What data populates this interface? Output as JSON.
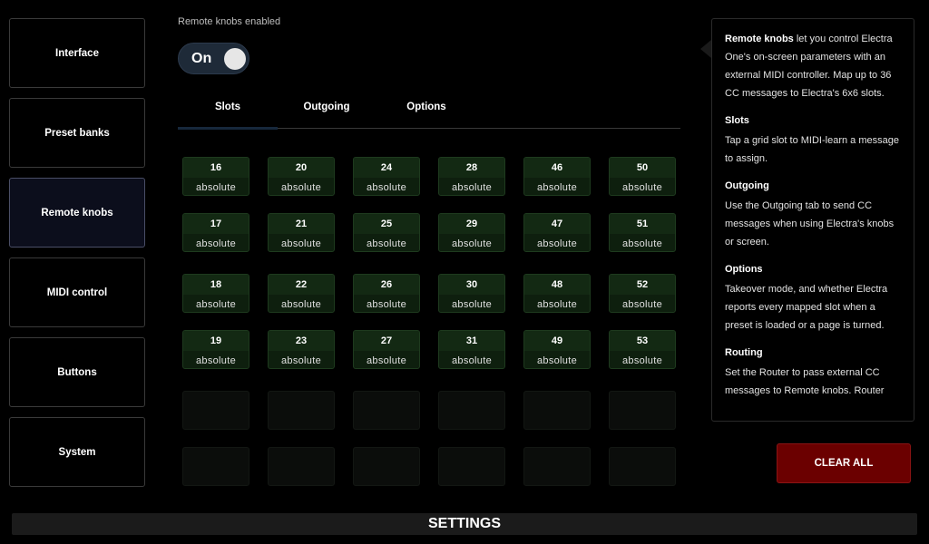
{
  "sidebar": {
    "items": [
      {
        "label": "Interface",
        "active": false
      },
      {
        "label": "Preset banks",
        "active": false
      },
      {
        "label": "Remote knobs",
        "active": true
      },
      {
        "label": "MIDI control",
        "active": false
      },
      {
        "label": "Buttons",
        "active": false
      },
      {
        "label": "System",
        "active": false
      }
    ]
  },
  "main": {
    "enabled_label": "Remote knobs enabled",
    "toggle": {
      "label": "On",
      "state": true
    },
    "tabs": [
      {
        "label": "Slots",
        "active": true
      },
      {
        "label": "Outgoing",
        "active": false
      },
      {
        "label": "Options",
        "active": false
      }
    ],
    "slot_rows": [
      [
        {
          "cc": "16",
          "mode": "absolute"
        },
        {
          "cc": "20",
          "mode": "absolute"
        },
        {
          "cc": "24",
          "mode": "absolute"
        },
        {
          "cc": "28",
          "mode": "absolute"
        },
        {
          "cc": "46",
          "mode": "absolute"
        },
        {
          "cc": "50",
          "mode": "absolute"
        }
      ],
      [
        {
          "cc": "17",
          "mode": "absolute"
        },
        {
          "cc": "21",
          "mode": "absolute"
        },
        {
          "cc": "25",
          "mode": "absolute"
        },
        {
          "cc": "29",
          "mode": "absolute"
        },
        {
          "cc": "47",
          "mode": "absolute"
        },
        {
          "cc": "51",
          "mode": "absolute"
        }
      ],
      [
        {
          "cc": "18",
          "mode": "absolute"
        },
        {
          "cc": "22",
          "mode": "absolute"
        },
        {
          "cc": "26",
          "mode": "absolute"
        },
        {
          "cc": "30",
          "mode": "absolute"
        },
        {
          "cc": "48",
          "mode": "absolute"
        },
        {
          "cc": "52",
          "mode": "absolute"
        }
      ],
      [
        {
          "cc": "19",
          "mode": "absolute"
        },
        {
          "cc": "23",
          "mode": "absolute"
        },
        {
          "cc": "27",
          "mode": "absolute"
        },
        {
          "cc": "31",
          "mode": "absolute"
        },
        {
          "cc": "49",
          "mode": "absolute"
        },
        {
          "cc": "53",
          "mode": "absolute"
        }
      ],
      [
        null,
        null,
        null,
        null,
        null,
        null
      ],
      [
        null,
        null,
        null,
        null,
        null,
        null
      ]
    ]
  },
  "help": {
    "intro_bold": "Remote knobs",
    "intro_text": " let you control Electra One's on-screen parameters with an external MIDI controller. Map up to 36 CC messages to Electra's 6x6 slots.",
    "sections": [
      {
        "title": "Slots",
        "text": "Tap a grid slot to MIDI-learn a message to assign."
      },
      {
        "title": "Outgoing",
        "text": "Use the Outgoing tab to send CC messages when using Electra's knobs or screen."
      },
      {
        "title": "Options",
        "text": "Takeover mode, and whether Electra reports every mapped slot when a preset is loaded or a page is turned."
      },
      {
        "title": "Routing",
        "text": "Set the Router to pass external CC messages to Remote knobs. Router"
      }
    ]
  },
  "clear_all_label": "CLEAR ALL",
  "footer_title": "SETTINGS",
  "colors": {
    "active_tab_underline": "#17283c",
    "slot_bg": "#0e1f0e",
    "clear_button": "#6b0000",
    "toggle_bg": "#1e2a38"
  }
}
